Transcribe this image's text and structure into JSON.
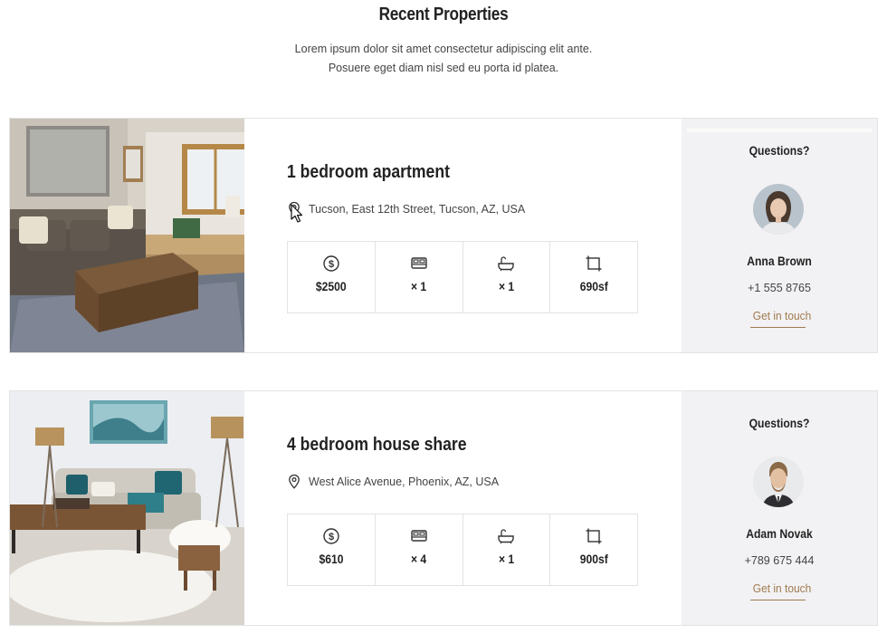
{
  "header": {
    "title": "Recent Properties",
    "subtitle_line1": "Lorem ipsum dolor sit amet consectetur adipiscing elit ante.",
    "subtitle_line2": "Posuere eget diam nisl sed eu porta id platea."
  },
  "properties": [
    {
      "title": "1 bedroom apartment",
      "address": "Tucson, East 12th Street, Tucson, AZ, USA",
      "price": "$2500",
      "beds": "× 1",
      "baths": "× 1",
      "area": "690sf",
      "contact": {
        "question": "Questions?",
        "name": "Anna Brown",
        "phone": "+1 555 8765",
        "cta": "Get in touch"
      }
    },
    {
      "title": "4 bedroom house share",
      "address": "West Alice Avenue, Phoenix, AZ, USA",
      "price": "$610",
      "beds": "× 4",
      "baths": "× 1",
      "area": "900sf",
      "contact": {
        "question": "Questions?",
        "name": "Adam Novak",
        "phone": "+789 675 444",
        "cta": "Get in touch"
      }
    }
  ],
  "icons": {
    "price": "dollar-circle-icon",
    "beds": "bed-icon",
    "baths": "bathtub-icon",
    "area": "area-square-icon",
    "address": "map-pin-icon"
  },
  "colors": {
    "accent": "#a07a4e",
    "contact_bg": "#f2f2f4",
    "border": "#e3e3e3",
    "text_dark": "#222222"
  }
}
